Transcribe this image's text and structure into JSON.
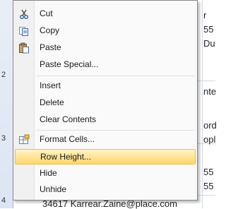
{
  "menu": {
    "items": [
      {
        "label": "Cut",
        "icon": "scissors-icon"
      },
      {
        "label": "Copy",
        "icon": "copy-icon"
      },
      {
        "label": "Paste",
        "icon": "paste-icon"
      },
      {
        "label": "Paste Special..."
      },
      {
        "label": "Insert"
      },
      {
        "label": "Delete"
      },
      {
        "label": "Clear Contents"
      },
      {
        "label": "Format Cells...",
        "icon": "format-cells-icon"
      },
      {
        "label": "Row Height..."
      },
      {
        "label": "Hide"
      },
      {
        "label": "Unhide"
      }
    ],
    "highlighted": "Row Height...",
    "highlight_color": "#ffd66b"
  },
  "sheet": {
    "row_numbers": [
      "2",
      "3",
      "4"
    ],
    "right_cells": [
      "r",
      "55",
      "Du",
      "nte",
      "ord",
      "opl",
      "55",
      "55"
    ],
    "bottom_text": "34617 Karrear.Zaine@place.com"
  }
}
